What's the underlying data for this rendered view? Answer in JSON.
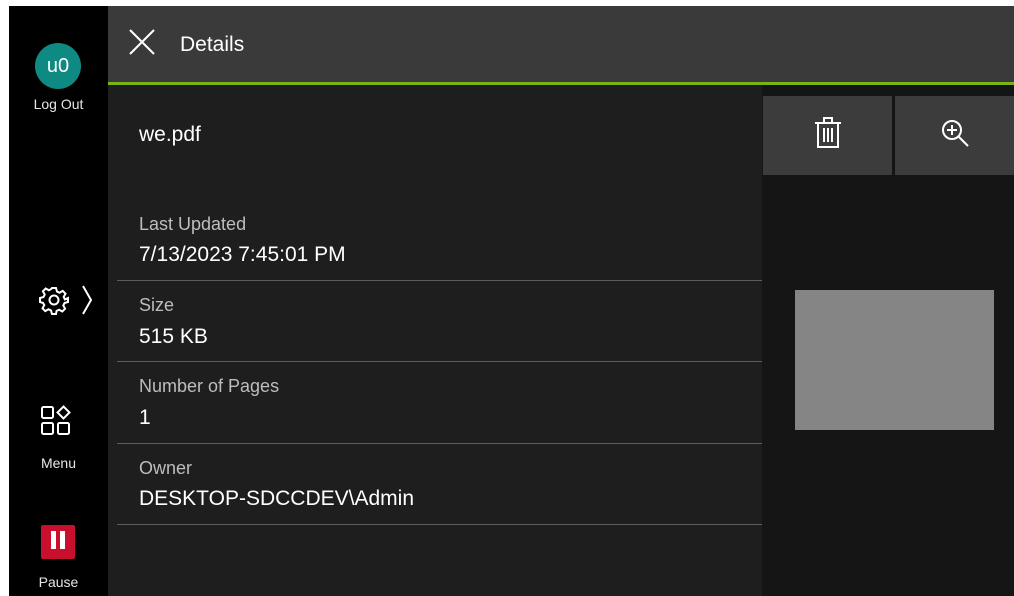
{
  "sidebar": {
    "avatar_text": "u0",
    "logout_label": "Log Out",
    "menu_label": "Menu",
    "pause_label": "Pause"
  },
  "header": {
    "title": "Details"
  },
  "file": {
    "name": "we.pdf"
  },
  "fields": [
    {
      "label": "Last Updated",
      "value": "7/13/2023 7:45:01 PM"
    },
    {
      "label": "Size",
      "value": "515 KB"
    },
    {
      "label": "Number of Pages",
      "value": "1"
    },
    {
      "label": "Owner",
      "value": "DESKTOP-SDCCDEV\\Admin"
    }
  ],
  "actions": {
    "delete_icon": "trash-icon",
    "zoom_icon": "zoom-in-icon"
  },
  "colors": {
    "accent": "#7ab317",
    "avatar": "#0e8a83",
    "pause": "#c8102e"
  }
}
